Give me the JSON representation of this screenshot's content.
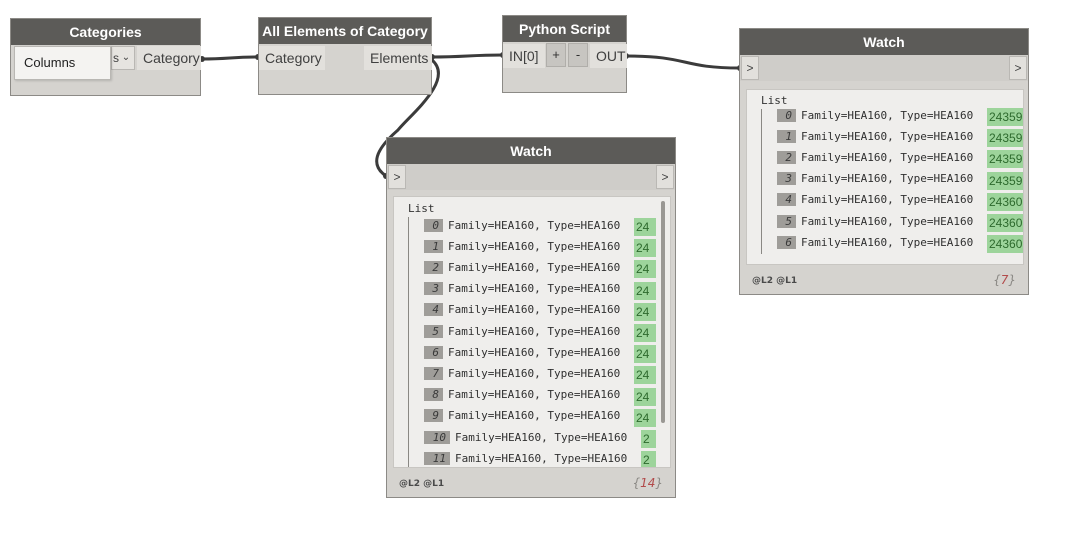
{
  "categories_node": {
    "title": "Categories",
    "dropdown_value": "Columns",
    "dropdown_partial": "s",
    "chevron": "⌄",
    "output": "Category"
  },
  "all_elements_node": {
    "title": "All Elements of Category",
    "input": "Category",
    "output": "Elements"
  },
  "python_node": {
    "title": "Python Script",
    "input": "IN[0]",
    "add_label": "+",
    "remove_label": "-",
    "output": "OUT"
  },
  "watch_right": {
    "title": "Watch",
    "in_port": ">",
    "out_port": ">",
    "list_label": "List",
    "levels": "@L2 @L1",
    "count": "7",
    "items": [
      {
        "index": "0",
        "text": "Family=HEA160, Type=HEA160",
        "value": "24359"
      },
      {
        "index": "1",
        "text": "Family=HEA160, Type=HEA160",
        "value": "24359"
      },
      {
        "index": "2",
        "text": "Family=HEA160, Type=HEA160",
        "value": "24359"
      },
      {
        "index": "3",
        "text": "Family=HEA160, Type=HEA160",
        "value": "24359"
      },
      {
        "index": "4",
        "text": "Family=HEA160, Type=HEA160",
        "value": "24360"
      },
      {
        "index": "5",
        "text": "Family=HEA160, Type=HEA160",
        "value": "24360"
      },
      {
        "index": "6",
        "text": "Family=HEA160, Type=HEA160",
        "value": "24360"
      }
    ]
  },
  "watch_bottom": {
    "title": "Watch",
    "in_port": ">",
    "out_port": ">",
    "list_label": "List",
    "levels": "@L2 @L1",
    "count": "14",
    "items": [
      {
        "index": "0",
        "text": "Family=HEA160, Type=HEA160",
        "value": "24"
      },
      {
        "index": "1",
        "text": "Family=HEA160, Type=HEA160",
        "value": "24"
      },
      {
        "index": "2",
        "text": "Family=HEA160, Type=HEA160",
        "value": "24"
      },
      {
        "index": "3",
        "text": "Family=HEA160, Type=HEA160",
        "value": "24"
      },
      {
        "index": "4",
        "text": "Family=HEA160, Type=HEA160",
        "value": "24"
      },
      {
        "index": "5",
        "text": "Family=HEA160, Type=HEA160",
        "value": "24"
      },
      {
        "index": "6",
        "text": "Family=HEA160, Type=HEA160",
        "value": "24"
      },
      {
        "index": "7",
        "text": "Family=HEA160, Type=HEA160",
        "value": "24"
      },
      {
        "index": "8",
        "text": "Family=HEA160, Type=HEA160",
        "value": "24"
      },
      {
        "index": "9",
        "text": "Family=HEA160, Type=HEA160",
        "value": "24"
      },
      {
        "index": "10",
        "text": "Family=HEA160, Type=HEA160",
        "value": "2"
      },
      {
        "index": "11",
        "text": "Family=HEA160, Type=HEA160",
        "value": "2"
      }
    ]
  },
  "colors": {
    "canvas": "#ffffff",
    "node_body": "#d5d3cf",
    "node_header": "#5c5b58",
    "wire": "#3b3b3b",
    "value_green": "#9dd49b",
    "count_red": "#b24a4a"
  }
}
